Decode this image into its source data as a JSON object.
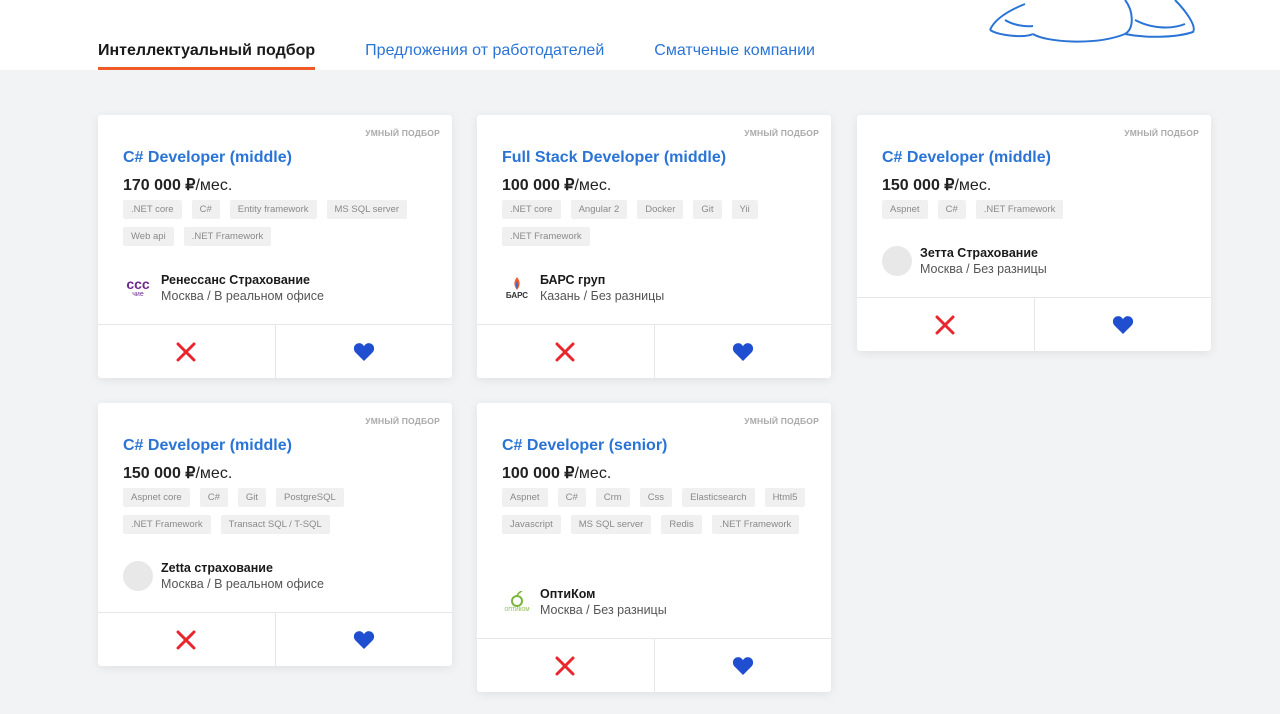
{
  "tabs": [
    {
      "label": "Интеллектуальный подбор"
    },
    {
      "label": "Предложения от работодателей"
    },
    {
      "label": "Сматченые компании"
    }
  ],
  "colors": {
    "accent": "#2a74d6",
    "tab_underline": "#f05a28",
    "reject": "#e8262c",
    "like": "#1f4fd0"
  },
  "cards": [
    {
      "badge": "УМНЫЙ ПОДБОР",
      "title": "C# Developer (middle)",
      "salary": "170 000 ₽",
      "salary_unit": "/мес.",
      "tags": [
        ".NET core",
        "C#",
        "Entity framework",
        "MS SQL server",
        "Web api",
        ".NET Framework"
      ],
      "company": {
        "name": "Ренессанс Страхование",
        "location": "Москва / В реальном офисе",
        "logo_text": "ccc",
        "logo_subtext": "чие"
      }
    },
    {
      "badge": "УМНЫЙ ПОДБОР",
      "title": "Full Stack Developer (middle)",
      "salary": "100 000 ₽",
      "salary_unit": "/мес.",
      "tags": [
        ".NET core",
        "Angular 2",
        "Docker",
        "Git",
        "Yii",
        ".NET Framework"
      ],
      "company": {
        "name": "БАРС груп",
        "location": "Казань / Без разницы",
        "logo_text": "БАРС"
      }
    },
    {
      "badge": "УМНЫЙ ПОДБОР",
      "title": "C# Developer (middle)",
      "salary": "150 000 ₽",
      "salary_unit": "/мес.",
      "tags": [
        "Aspnet",
        "C#",
        ".NET Framework"
      ],
      "company": {
        "name": "Зетта Страхование",
        "location": "Москва / Без разницы"
      }
    },
    {
      "badge": "УМНЫЙ ПОДБОР",
      "title": "C# Developer (middle)",
      "salary": "150 000 ₽",
      "salary_unit": "/мес.",
      "tags": [
        "Aspnet core",
        "C#",
        "Git",
        "PostgreSQL",
        ".NET Framework",
        "Transact SQL / T-SQL"
      ],
      "company": {
        "name": "Zetta страхование",
        "location": "Москва / В реальном офисе"
      }
    },
    {
      "badge": "УМНЫЙ ПОДБОР",
      "title": "C# Developer (senior)",
      "salary": "100 000 ₽",
      "salary_unit": "/мес.",
      "tags": [
        "Aspnet",
        "C#",
        "Crm",
        "Css",
        "Elasticsearch",
        "Html5",
        "Javascript",
        "MS SQL server",
        "Redis",
        ".NET Framework"
      ],
      "company": {
        "name": "ОптиКом",
        "location": "Москва / Без разницы",
        "logo_text": "ОПТИКОМ"
      }
    }
  ]
}
